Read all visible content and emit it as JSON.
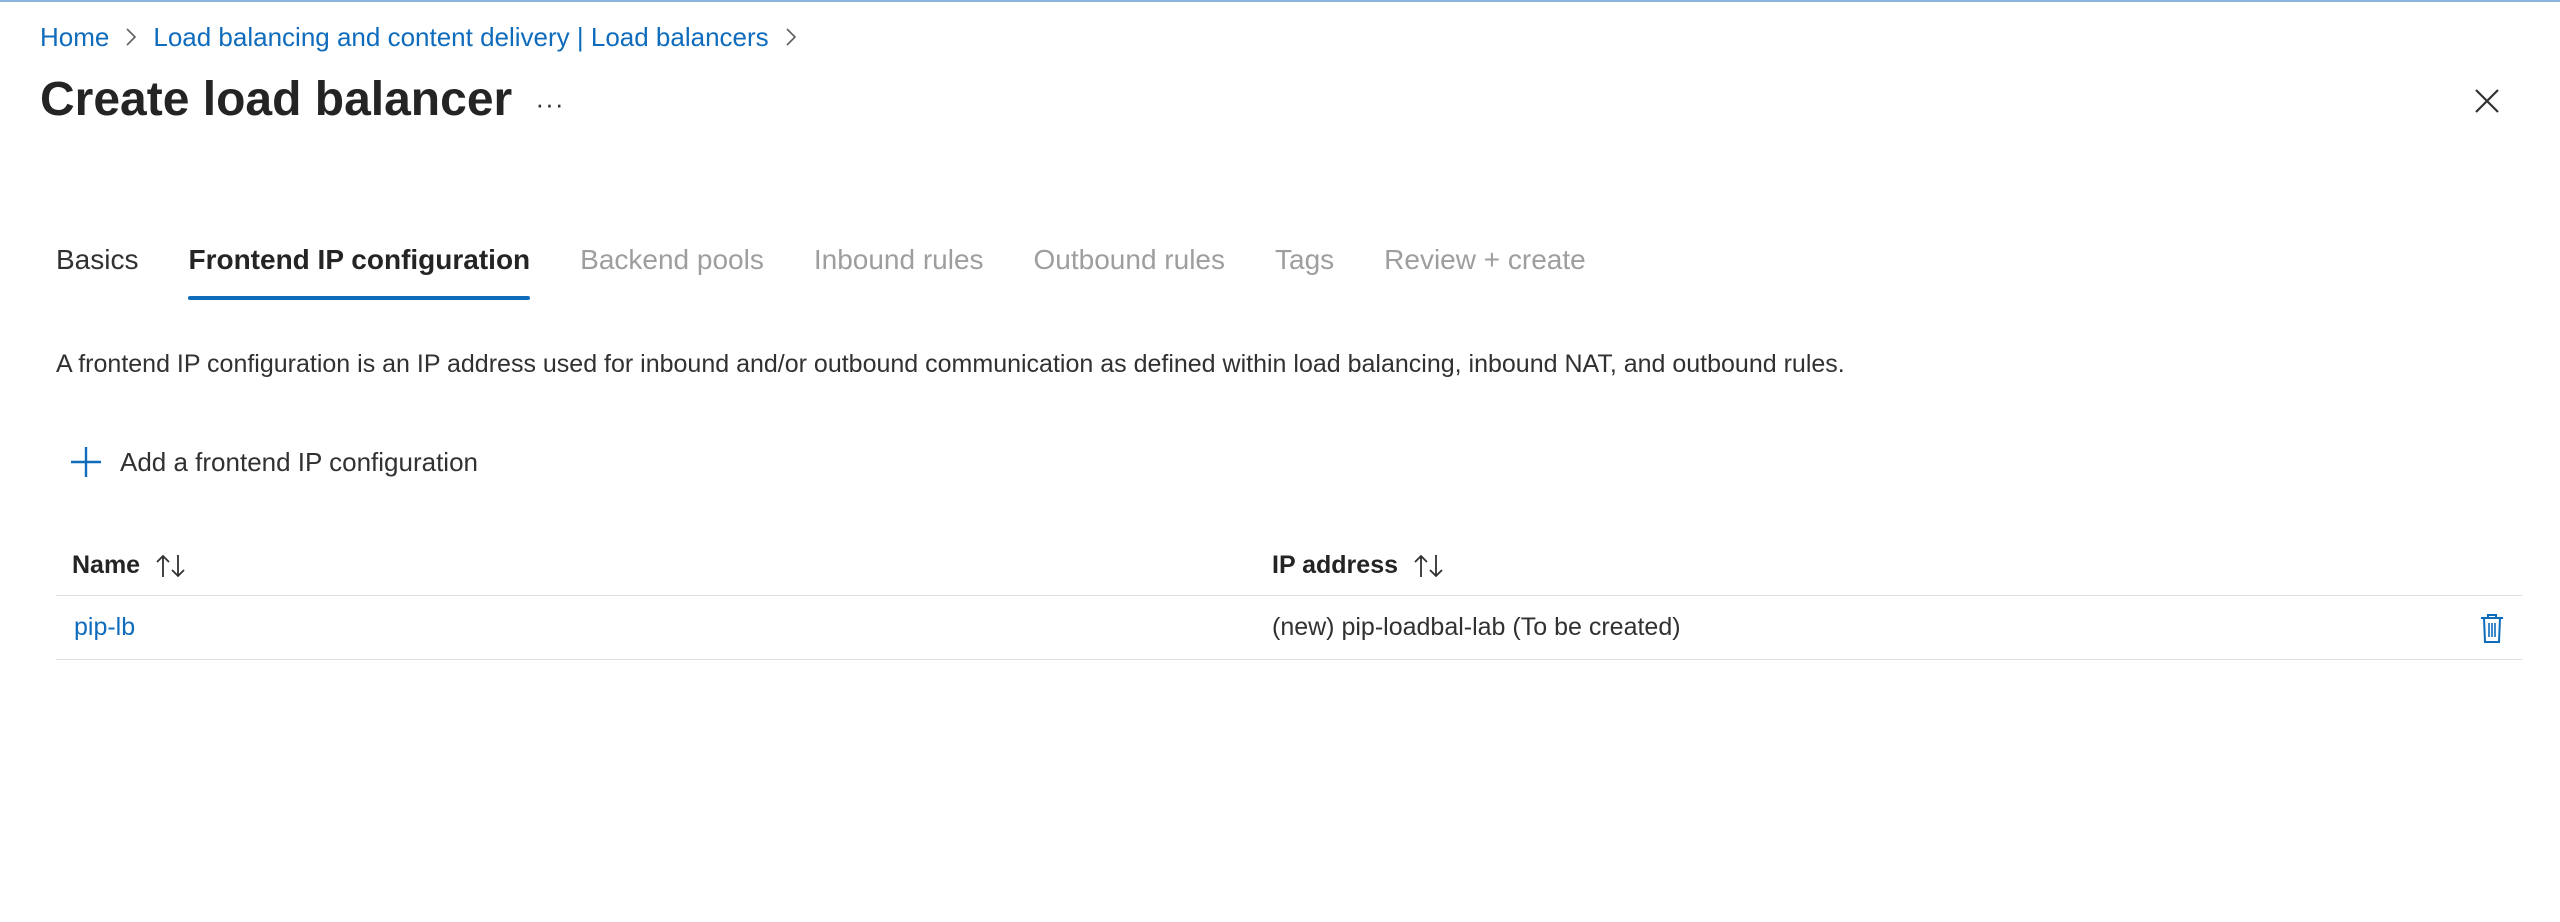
{
  "breadcrumb": {
    "items": [
      {
        "label": "Home",
        "icon": "chevron-right-icon"
      },
      {
        "label": "Load balancing and content delivery | Load balancers",
        "icon": "chevron-right-icon"
      }
    ]
  },
  "header": {
    "title": "Create load balancer",
    "more_label": "···",
    "close_icon": "close-icon"
  },
  "tabs": [
    {
      "label": "Basics",
      "state": "enabled"
    },
    {
      "label": "Frontend IP configuration",
      "state": "active"
    },
    {
      "label": "Backend pools",
      "state": "disabled"
    },
    {
      "label": "Inbound rules",
      "state": "disabled"
    },
    {
      "label": "Outbound rules",
      "state": "disabled"
    },
    {
      "label": "Tags",
      "state": "disabled"
    },
    {
      "label": "Review + create",
      "state": "disabled"
    }
  ],
  "main": {
    "description": "A frontend IP configuration is an IP address used for inbound and/or outbound communication as defined within load balancing, inbound NAT, and outbound rules.",
    "add_button": {
      "label": "Add a frontend IP configuration",
      "icon": "plus-icon"
    },
    "table": {
      "columns": [
        {
          "label": "Name",
          "sort_icon": "sort-icon"
        },
        {
          "label": "IP address",
          "sort_icon": "sort-icon"
        }
      ],
      "rows": [
        {
          "name": "pip-lb",
          "ip_address": "(new) pip-loadbal-lab (To be created)",
          "action_icon": "delete-icon"
        }
      ]
    }
  },
  "colors": {
    "accent": "#0f6cbd",
    "text": "#323130",
    "disabled": "#9e9e9e",
    "divider": "#e1dfdd"
  }
}
